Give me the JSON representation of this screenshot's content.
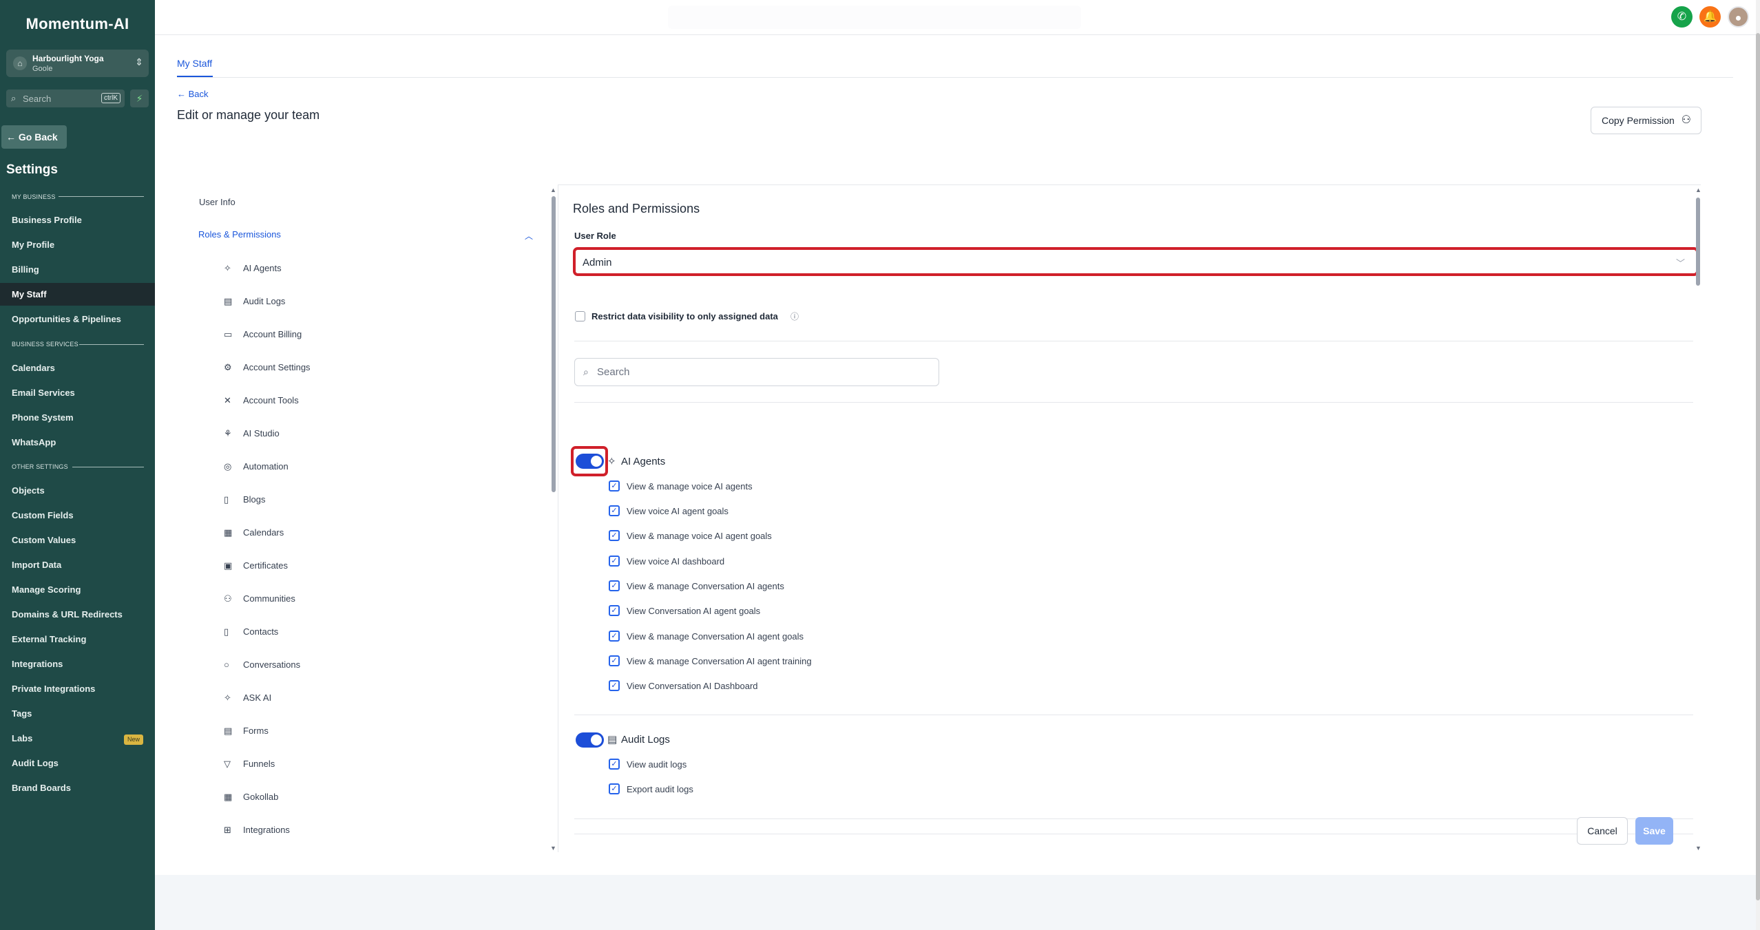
{
  "sidebar": {
    "brand": "Momentum-AI",
    "account": {
      "name": "Harbourlight Yoga",
      "sub": "Goole"
    },
    "search": {
      "placeholder": "Search",
      "shortcut": "ctrlK"
    },
    "go_back": "Go Back",
    "settings_title": "Settings",
    "sections": {
      "my_business": "MY BUSINESS",
      "business_services": "BUSINESS SERVICES",
      "other_settings": "OTHER SETTINGS"
    },
    "my_business_items": [
      "Business Profile",
      "My Profile",
      "Billing",
      "My Staff",
      "Opportunities & Pipelines"
    ],
    "business_services_items": [
      "Calendars",
      "Email Services",
      "Phone System",
      "WhatsApp"
    ],
    "other_settings_items": [
      "Objects",
      "Custom Fields",
      "Custom Values",
      "Import Data",
      "Manage Scoring",
      "Domains & URL Redirects",
      "External Tracking",
      "Integrations",
      "Private Integrations",
      "Tags",
      "Labs",
      "Audit Logs",
      "Brand Boards"
    ],
    "labs_badge": "New",
    "active_item": "My Staff"
  },
  "topbar": {
    "phone_color": "#16a34a",
    "bell_color": "#f97316"
  },
  "content": {
    "tab": "My Staff",
    "back": "Back",
    "title": "Edit or manage your team",
    "copy_button": "Copy Permission",
    "side_nav": {
      "user_info": "User Info",
      "roles": "Roles & Permissions",
      "items": [
        {
          "icon": "sparkles-icon",
          "label": "AI Agents"
        },
        {
          "icon": "clipboard-icon",
          "label": "Audit Logs"
        },
        {
          "icon": "credit-card-icon",
          "label": "Account Billing"
        },
        {
          "icon": "settings-grid-icon",
          "label": "Account Settings"
        },
        {
          "icon": "tools-icon",
          "label": "Account Tools"
        },
        {
          "icon": "ai-studio-icon",
          "label": "AI Studio"
        },
        {
          "icon": "automation-icon",
          "label": "Automation"
        },
        {
          "icon": "document-icon",
          "label": "Blogs"
        },
        {
          "icon": "calendar-icon",
          "label": "Calendars"
        },
        {
          "icon": "certificate-icon",
          "label": "Certificates"
        },
        {
          "icon": "users-icon",
          "label": "Communities"
        },
        {
          "icon": "contact-icon",
          "label": "Contacts"
        },
        {
          "icon": "chat-icon",
          "label": "Conversations"
        },
        {
          "icon": "sparkles-icon",
          "label": "ASK AI"
        },
        {
          "icon": "form-icon",
          "label": "Forms"
        },
        {
          "icon": "funnel-icon",
          "label": "Funnels"
        },
        {
          "icon": "gokollab-icon",
          "label": "Gokollab"
        },
        {
          "icon": "integrations-icon",
          "label": "Integrations"
        }
      ]
    },
    "panel": {
      "title": "Roles and Permissions",
      "user_role_label": "User Role",
      "user_role_value": "Admin",
      "restrict_label": "Restrict data visibility to only assigned data",
      "search_placeholder": "Search",
      "groups": [
        {
          "title": "AI Agents",
          "enabled": true,
          "permissions": [
            "View & manage voice AI agents",
            "View voice AI agent goals",
            "View & manage voice AI agent goals",
            "View voice AI dashboard",
            "View & manage Conversation AI agents",
            "View Conversation AI agent goals",
            "View & manage Conversation AI agent goals",
            "View & manage Conversation AI agent training",
            "View Conversation AI Dashboard"
          ]
        },
        {
          "title": "Audit Logs",
          "enabled": true,
          "permissions": [
            "View audit logs",
            "Export audit logs"
          ]
        }
      ],
      "cancel": "Cancel",
      "save": "Save"
    }
  }
}
